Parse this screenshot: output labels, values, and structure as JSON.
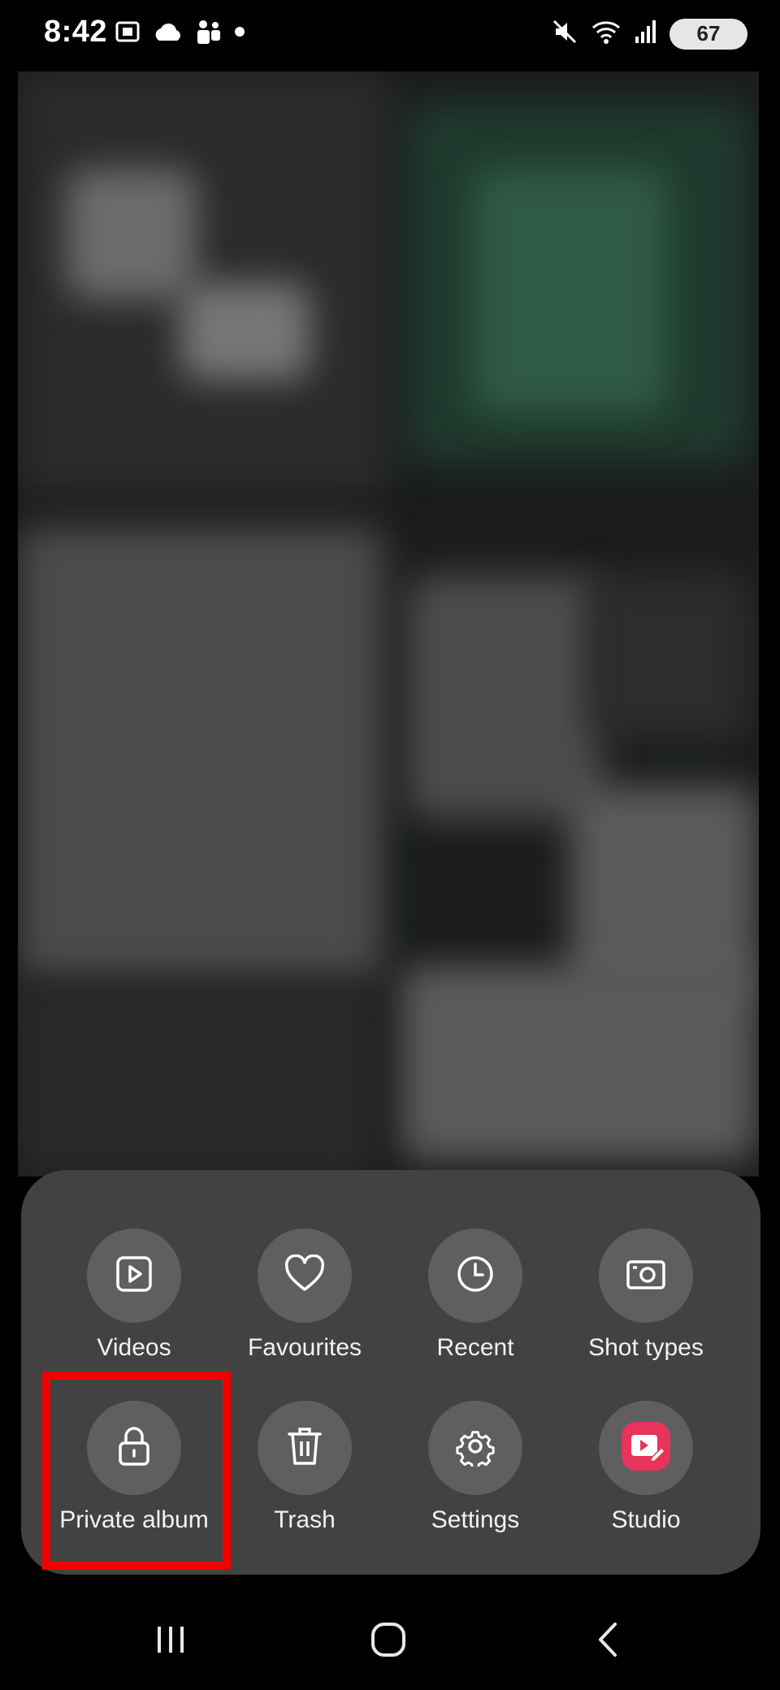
{
  "status_bar": {
    "time": "8:42",
    "battery": "67",
    "left_icons": [
      "screen-recorder-icon",
      "cloud-icon",
      "teams-icon",
      "dot-icon"
    ],
    "right_icons": [
      "mute-icon",
      "wifi-icon",
      "signal-icon"
    ]
  },
  "menu": {
    "items": [
      {
        "label": "Videos",
        "icon": "video-icon"
      },
      {
        "label": "Favourites",
        "icon": "heart-icon"
      },
      {
        "label": "Recent",
        "icon": "clock-icon"
      },
      {
        "label": "Shot types",
        "icon": "camera-icon"
      },
      {
        "label": "Private album",
        "icon": "lock-icon"
      },
      {
        "label": "Trash",
        "icon": "trash-icon"
      },
      {
        "label": "Settings",
        "icon": "gear-icon"
      },
      {
        "label": "Studio",
        "icon": "studio-icon"
      }
    ],
    "highlighted": "Private album"
  },
  "colors": {
    "sheet_bg": "#424243",
    "icon_circle": "#5f5f60",
    "highlight": "#f20000",
    "studio_accent": "#e8335a"
  },
  "nav": {
    "buttons": [
      "recents-button",
      "home-button",
      "back-button"
    ]
  }
}
